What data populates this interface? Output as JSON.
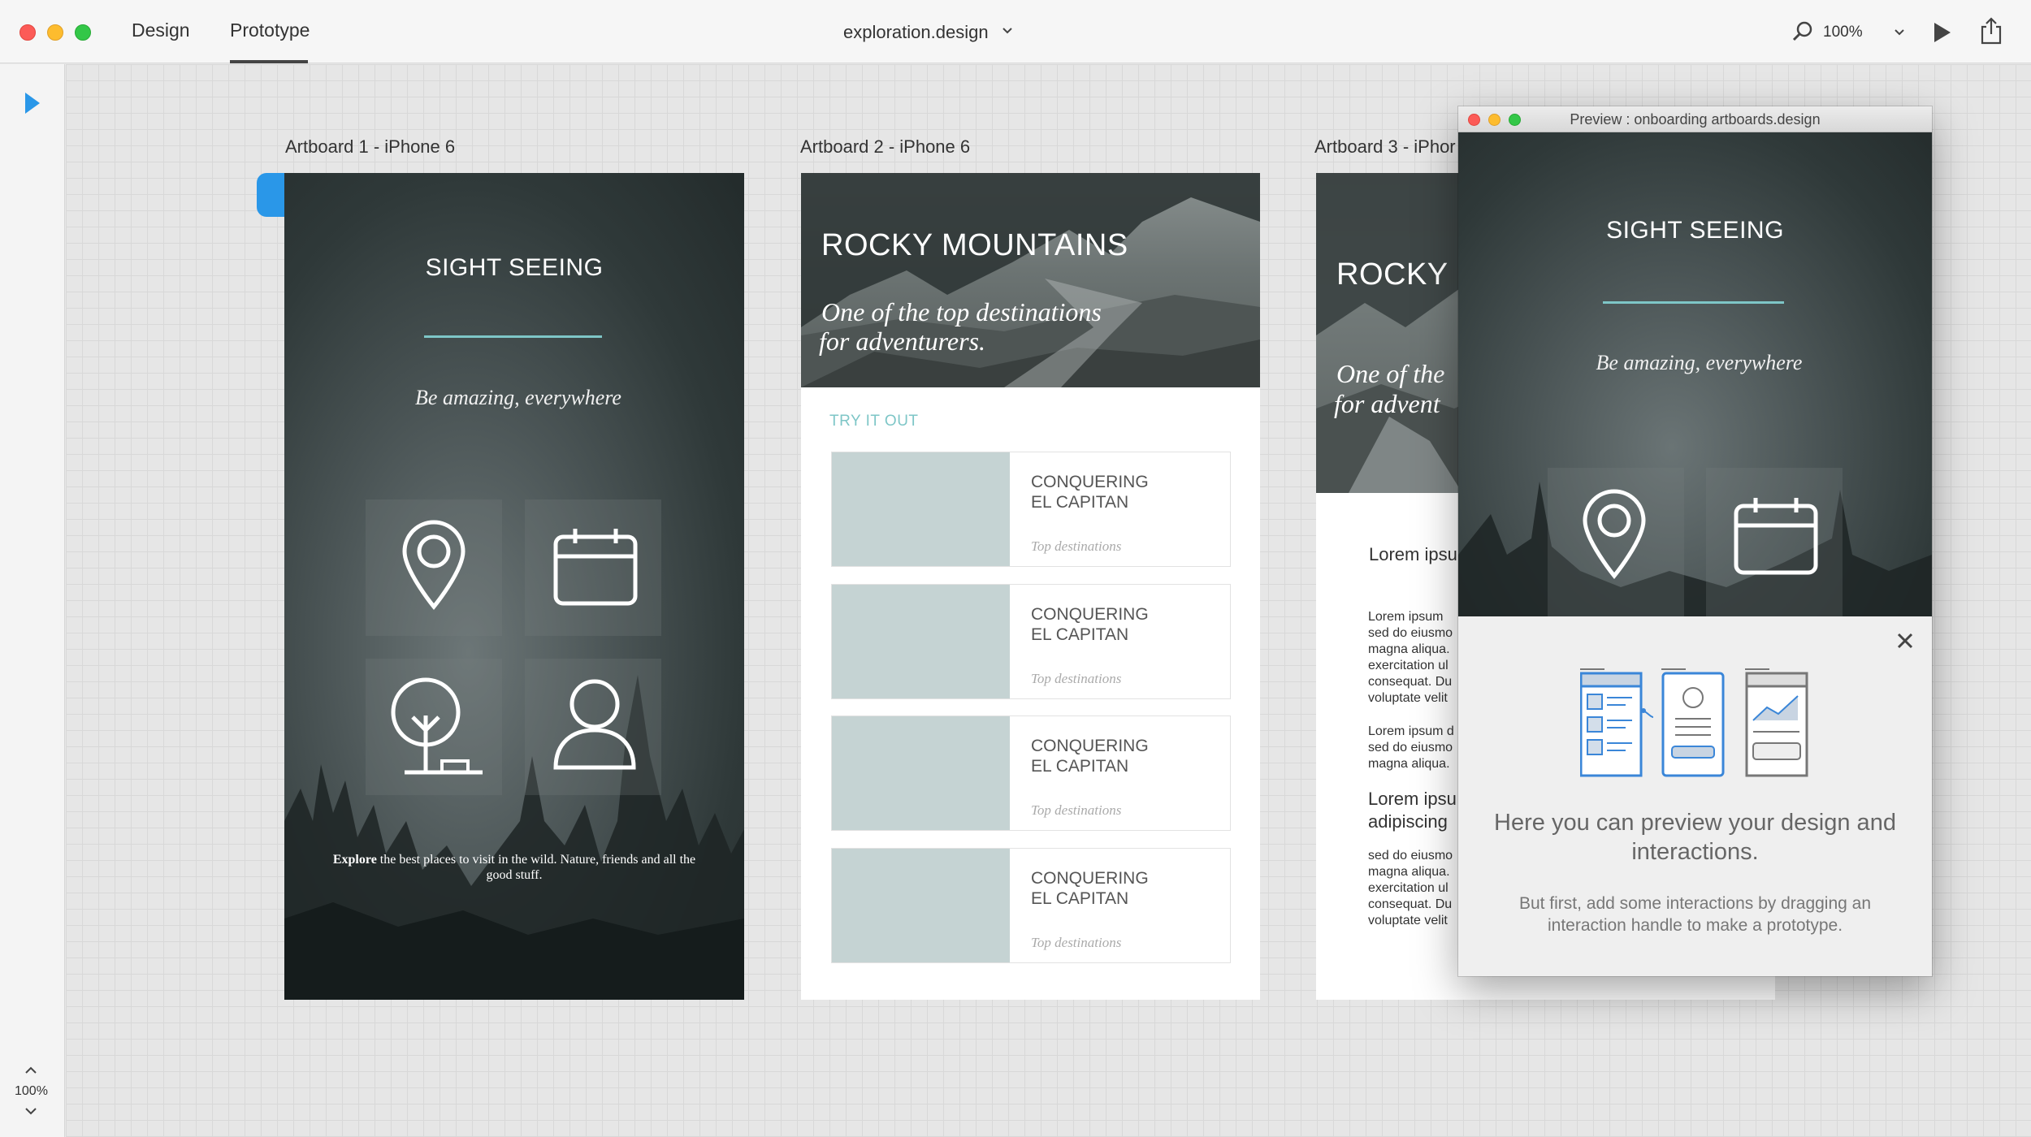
{
  "titlebar": {
    "tabs": {
      "design": "Design",
      "prototype": "Prototype"
    },
    "document_title": "exploration.design",
    "zoom": "100%"
  },
  "lefttoolbar": {
    "zoom": "100%"
  },
  "artboards": {
    "one": {
      "label": "Artboard 1 - iPhone 6",
      "title": "SIGHT SEEING",
      "tagline": "Be amazing, everywhere",
      "footer_bold": "Explore",
      "footer_text": " the best places to visit in the wild. Nature, friends and all the good stuff."
    },
    "two": {
      "label": "Artboard 2 - iPhone 6",
      "hero_title": "ROCKY MOUNTAINS",
      "hero_sub_1": "One of the top destinations",
      "hero_sub_2": "for adventurers.",
      "section_label": "TRY IT OUT",
      "cards": [
        {
          "title_1": "CONQUERING",
          "title_2": "EL CAPITAN",
          "subtitle": "Top destinations"
        },
        {
          "title_1": "CONQUERING",
          "title_2": "EL CAPITAN",
          "subtitle": "Top destinations"
        },
        {
          "title_1": "CONQUERING",
          "title_2": "EL CAPITAN",
          "subtitle": "Top destinations"
        },
        {
          "title_1": "CONQUERING",
          "title_2": "EL CAPITAN",
          "subtitle": "Top destinations"
        }
      ]
    },
    "three": {
      "label": "Artboard 3 - iPhor",
      "hero_title": "ROCKY I",
      "hero_sub_1": "One of the",
      "hero_sub_2": "for advent",
      "heading_1": "Lorem ipsu",
      "para_1": [
        "Lorem ipsum",
        "sed do eiusmo",
        "magna aliqua.",
        "exercitation ul",
        "consequat. Du",
        "voluptate velit"
      ],
      "para_2": [
        "Lorem ipsum d",
        "sed do eiusmo",
        "magna aliqua."
      ],
      "heading_2a": "Lorem ipsu",
      "heading_2b": "adipiscing",
      "para_3": [
        "sed do eiusmo",
        "magna aliqua.",
        "exercitation ul",
        "consequat. Du",
        "voluptate velit"
      ]
    }
  },
  "preview": {
    "window_title": "Preview : onboarding artboards.design",
    "screen_title": "SIGHT SEEING",
    "screen_tagline": "Be amazing, everywhere",
    "heading": "Here you can preview your design and interactions.",
    "body": "But first, add some interactions by dragging an interaction handle to make a prototype."
  },
  "colors": {
    "accent": "#7ec6c7",
    "selection": "#2a97e8",
    "card_image": "#c5d3d3",
    "illustration": "#3a86d8"
  }
}
